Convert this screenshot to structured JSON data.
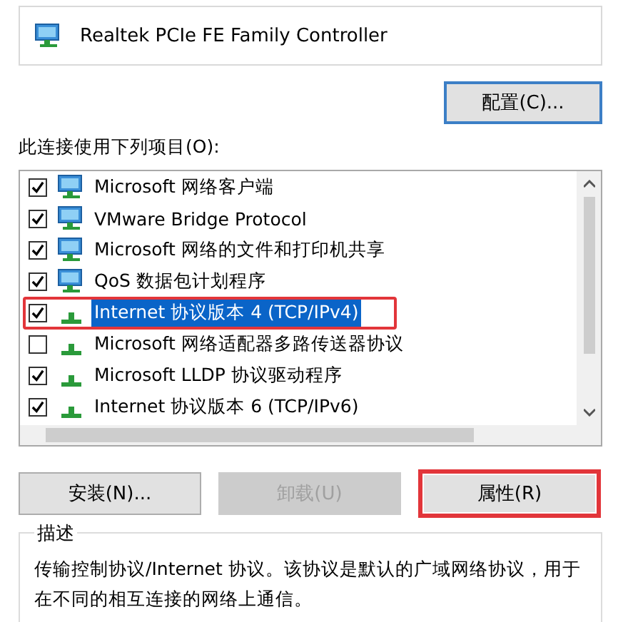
{
  "adapter": {
    "name": "Realtek PCIe FE Family Controller"
  },
  "configure_button": {
    "label": "配置(C)..."
  },
  "items_label": "此连接使用下列项目(O):",
  "items": [
    {
      "label": "Microsoft 网络客户端",
      "kind": "client",
      "checked": true,
      "selected": false,
      "highlighted": false
    },
    {
      "label": "VMware Bridge Protocol",
      "kind": "client",
      "checked": true,
      "selected": false,
      "highlighted": false
    },
    {
      "label": "Microsoft 网络的文件和打印机共享",
      "kind": "client",
      "checked": true,
      "selected": false,
      "highlighted": false
    },
    {
      "label": "QoS 数据包计划程序",
      "kind": "client",
      "checked": true,
      "selected": false,
      "highlighted": false
    },
    {
      "label": "Internet 协议版本 4 (TCP/IPv4)",
      "kind": "protocol",
      "checked": true,
      "selected": true,
      "highlighted": true
    },
    {
      "label": "Microsoft 网络适配器多路传送器协议",
      "kind": "protocol",
      "checked": false,
      "selected": false,
      "highlighted": false
    },
    {
      "label": "Microsoft LLDP 协议驱动程序",
      "kind": "protocol",
      "checked": true,
      "selected": false,
      "highlighted": false
    },
    {
      "label": "Internet 协议版本 6 (TCP/IPv6)",
      "kind": "protocol",
      "checked": true,
      "selected": false,
      "highlighted": false
    }
  ],
  "buttons": [
    {
      "label": "安装(N)...",
      "disabled": false,
      "highlighted": false
    },
    {
      "label": "卸载(U)",
      "disabled": true,
      "highlighted": false
    },
    {
      "label": "属性(R)",
      "disabled": false,
      "highlighted": true
    }
  ],
  "description": {
    "title": "描述",
    "text": "传输控制协议/Internet 协议。该协议是默认的广域网络协议，用于在不同的相互连接的网络上通信。"
  }
}
